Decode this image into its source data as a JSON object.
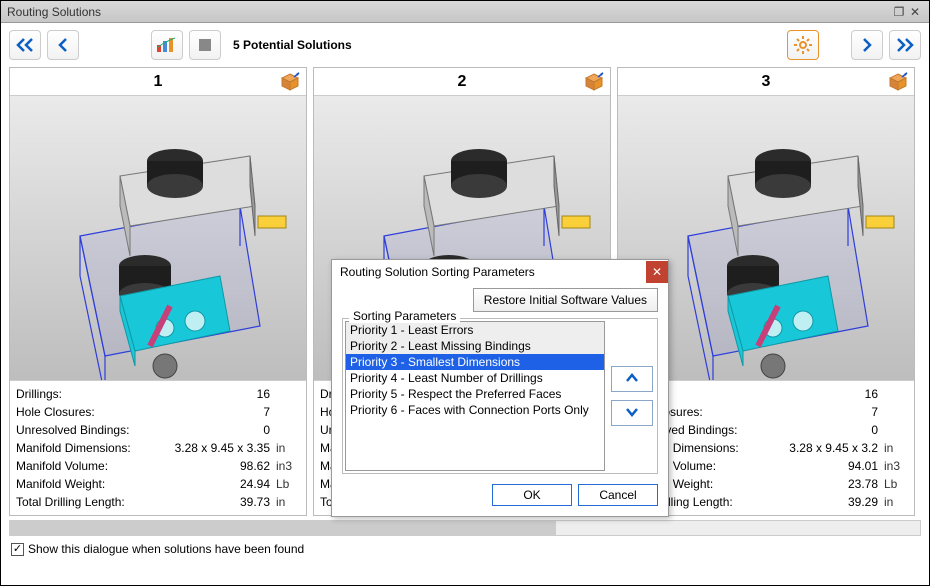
{
  "window": {
    "title": "Routing Solutions"
  },
  "toolbar": {
    "subtitle": "5 Potential Solutions"
  },
  "footer": {
    "checkbox_label": "Show this dialogue when solutions have been found",
    "checkbox_checked": true
  },
  "stat_labels": {
    "drillings": "Drillings:",
    "hole_closures": "Hole Closures:",
    "unresolved": "Unresolved Bindings:",
    "dims": "Manifold Dimensions:",
    "volume": "Manifold Volume:",
    "weight": "Manifold Weight:",
    "length": "Total Drilling Length:"
  },
  "units": {
    "dim": "in",
    "vol": "in3",
    "wt": "Lb",
    "len": "in"
  },
  "cards": [
    {
      "num": "1",
      "drillings": "16",
      "hole_closures": "7",
      "unresolved": "0",
      "dims": "3.28 x 9.45 x 3.35",
      "volume": "98.62",
      "weight": "24.94",
      "length": "39.73"
    },
    {
      "num": "2",
      "drillings": "",
      "hole_closures": "",
      "unresolved": "",
      "dims": "",
      "volume": "",
      "weight": "",
      "length": ""
    },
    {
      "num": "3",
      "drillings": "16",
      "hole_closures": "7",
      "unresolved": "0",
      "dims": "3.28 x 9.45 x 3.2",
      "volume": "94.01",
      "weight": "23.78",
      "length": "39.29"
    }
  ],
  "dialog": {
    "title": "Routing Solution Sorting Parameters",
    "restore": "Restore Initial Software Values",
    "legend": "Sorting Parameters",
    "items": [
      "Priority 1 - Least Errors",
      "Priority 2 - Least Missing Bindings",
      "Priority 3 - Smallest Dimensions",
      "Priority 4 - Least Number of Drillings",
      "Priority 5 - Respect the Preferred Faces",
      "Priority 6 - Faces with Connection Ports Only"
    ],
    "selected_index": 2,
    "ok": "OK",
    "cancel": "Cancel"
  }
}
